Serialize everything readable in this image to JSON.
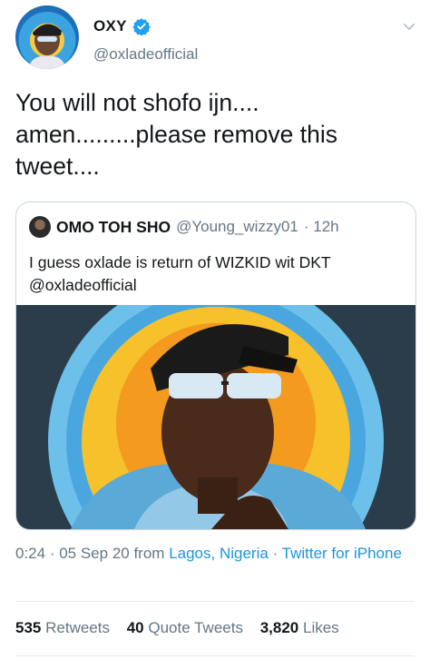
{
  "author": {
    "name": "OXY",
    "handle": "@oxladeofficial",
    "verified": true
  },
  "tweet": {
    "text": "You will not shofo ijn.... amen.........please remove this tweet...."
  },
  "quoted_tweet": {
    "name": "OMO TOH SHO",
    "handle": "@Young_wizzy01",
    "time": "· 12h",
    "text": "I guess oxlade is return of WIZKID wit DKT @oxladeofficial"
  },
  "meta": {
    "time": "0:24",
    "date": "· 05 Sep 20 from",
    "location": "Lagos, Nigeria",
    "separator": "·",
    "source": "Twitter for iPhone"
  },
  "stats": {
    "retweets_count": "535",
    "retweets_label": "Retweets",
    "quotes_count": "40",
    "quotes_label": "Quote Tweets",
    "likes_count": "3,820",
    "likes_label": "Likes"
  },
  "colors": {
    "accent": "#1b95e0",
    "secondary_text": "#657786",
    "primary_text": "#14171a",
    "border": "#ccd6dd"
  },
  "icons": [
    "verified-badge-icon",
    "chevron-down-icon"
  ]
}
